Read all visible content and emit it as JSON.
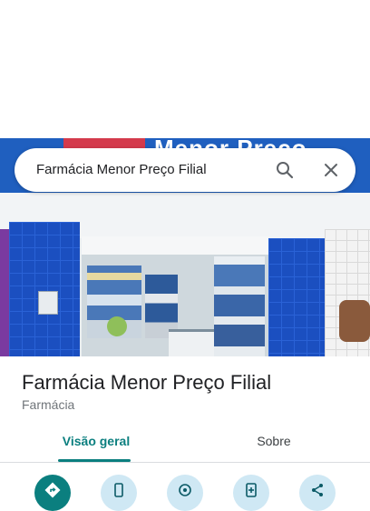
{
  "search": {
    "query": "Farmácia Menor Preço Filial"
  },
  "storefront": {
    "sign_text": "Menor Preço"
  },
  "place": {
    "name": "Farmácia Menor Preço Filial",
    "category": "Farmácia"
  },
  "tabs": [
    {
      "label": "Visão geral",
      "selected": true
    },
    {
      "label": "Sobre",
      "selected": false
    }
  ],
  "actions": [
    {
      "icon": "directions-icon"
    },
    {
      "icon": "phone-icon"
    },
    {
      "icon": "location-icon"
    },
    {
      "icon": "save-icon"
    },
    {
      "icon": "share-icon"
    }
  ],
  "colors": {
    "accent": "#0b7f7f",
    "action_bg": "#cfe8f4"
  }
}
